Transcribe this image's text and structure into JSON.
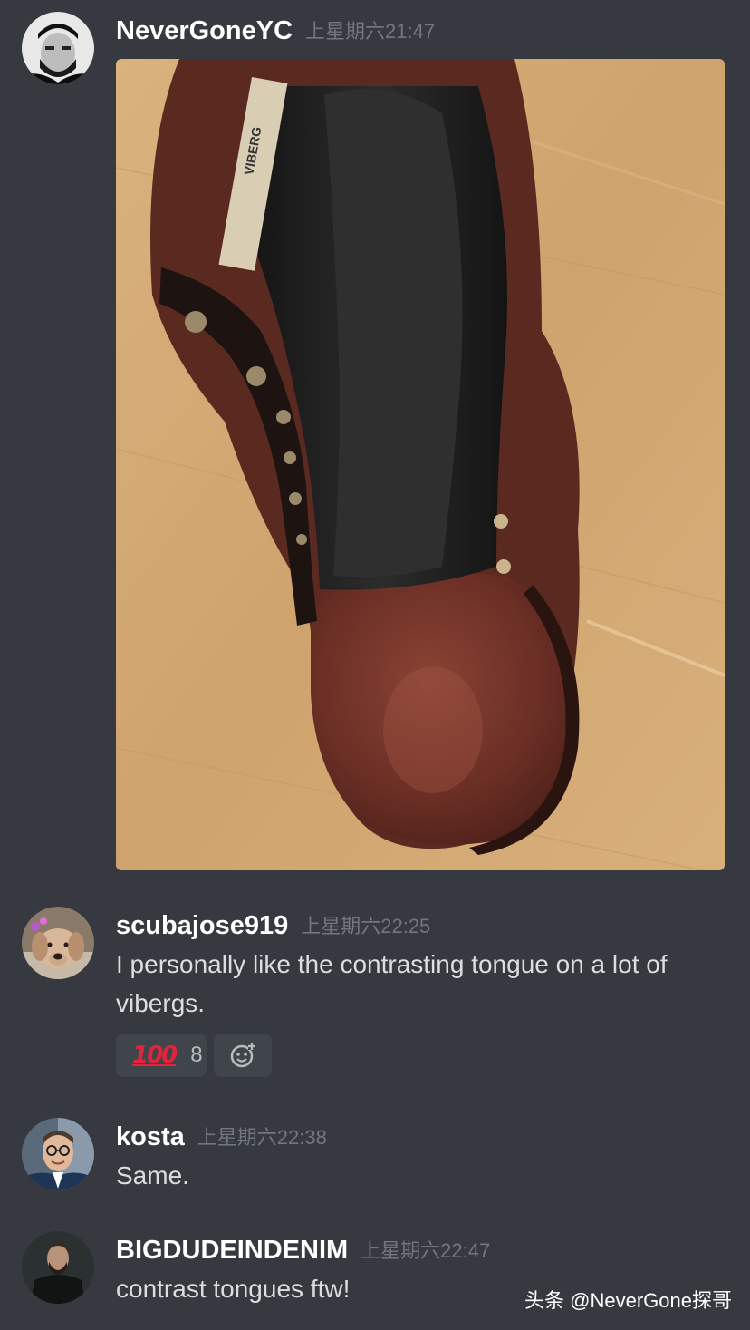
{
  "messages": [
    {
      "username": "NeverGoneYC",
      "timestamp": "上星期六21:47",
      "avatar_icon": "user-avatar-bearded-man-bw",
      "attachment": "photo-brown-leather-boot-vibergboot-tag"
    },
    {
      "username": "scubajose919",
      "timestamp": "上星期六22:25",
      "avatar_icon": "user-avatar-dog",
      "text": "I personally like the contrasting tongue on a lot of vibergs.",
      "reactions": [
        {
          "emoji": "💯",
          "emoji_fallback": "100",
          "count": "8"
        }
      ],
      "add_reaction_icon": "add-reaction-smiley-icon"
    },
    {
      "username": "kosta",
      "timestamp": "上星期六22:38",
      "avatar_icon": "user-avatar-man-glasses",
      "text": "Same."
    },
    {
      "username": "BIGDUDEINDENIM",
      "timestamp": "上星期六22:47",
      "avatar_icon": "user-avatar-man-dark-jacket",
      "text": "contrast tongues ftw!"
    }
  ],
  "watermark": "头条 @NeverGone探哥",
  "colors": {
    "background": "#36393f",
    "username": "#ffffff",
    "timestamp": "#72767d",
    "message_text": "#dcddde",
    "reaction_bg": "#40444b"
  }
}
